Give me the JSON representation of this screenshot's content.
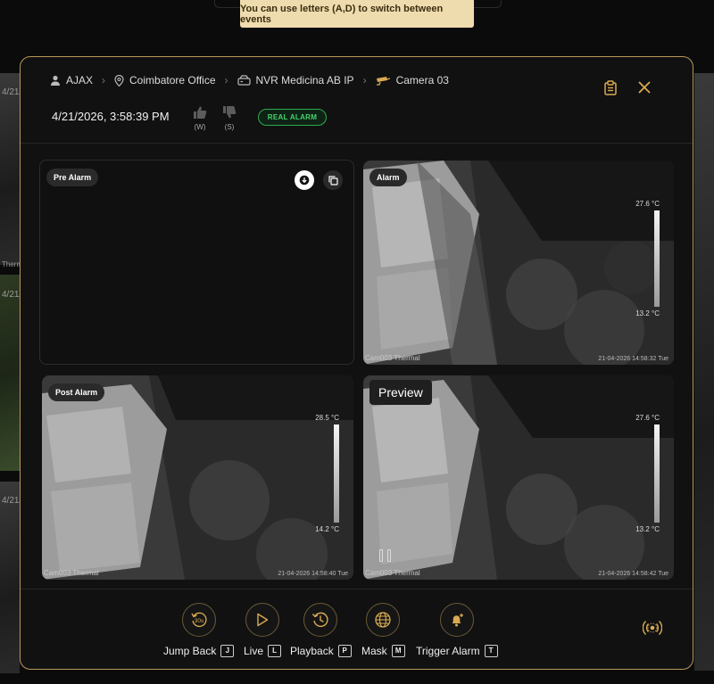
{
  "hint": "You can use letters (A,D) to switch between events",
  "background": {
    "dates": [
      "4/21/",
      "4/21/",
      "4/21/",
      "4/21/"
    ],
    "labels": [
      "Therm"
    ]
  },
  "breadcrumb": {
    "org": "AJAX",
    "site": "Coimbatore Office",
    "recorder": "NVR Medicina AB IP",
    "camera": "Camera 03"
  },
  "event": {
    "datetime": "4/21/2026, 3:58:39 PM",
    "like_key": "(W)",
    "dislike_key": "(S)",
    "status": "REAL ALARM",
    "status_color": "#44d46b"
  },
  "tiles": {
    "pre_alarm": {
      "label": "Pre Alarm"
    },
    "alarm": {
      "label": "Alarm",
      "camera": "Cam003 Thermal",
      "timestamp": "21-04-2026 14:58:32 Tue",
      "tmax": "27.6 °C",
      "tmin": "13.2 °C"
    },
    "post_alarm": {
      "label": "Post Alarm",
      "camera": "Cam003 Thermal",
      "timestamp": "21-04-2026 14:58:40 Tue",
      "tmax": "28.5 °C",
      "tmin": "14.2 °C"
    },
    "preview": {
      "label": "Preview",
      "camera": "Cam003 Thermal",
      "timestamp": "21-04-2026 14:58:42 Tue",
      "tmax": "27.6 °C",
      "tmin": "13.2 °C"
    }
  },
  "controls": [
    {
      "label": "Jump Back",
      "key": "J",
      "icon": "rewind-30-icon"
    },
    {
      "label": "Live",
      "key": "L",
      "icon": "play-icon"
    },
    {
      "label": "Playback",
      "key": "P",
      "icon": "history-icon"
    },
    {
      "label": "Mask",
      "key": "M",
      "icon": "globe-grid-icon"
    },
    {
      "label": "Trigger Alarm",
      "key": "T",
      "icon": "bell-plus-icon"
    }
  ],
  "accent": "#d9ab52"
}
